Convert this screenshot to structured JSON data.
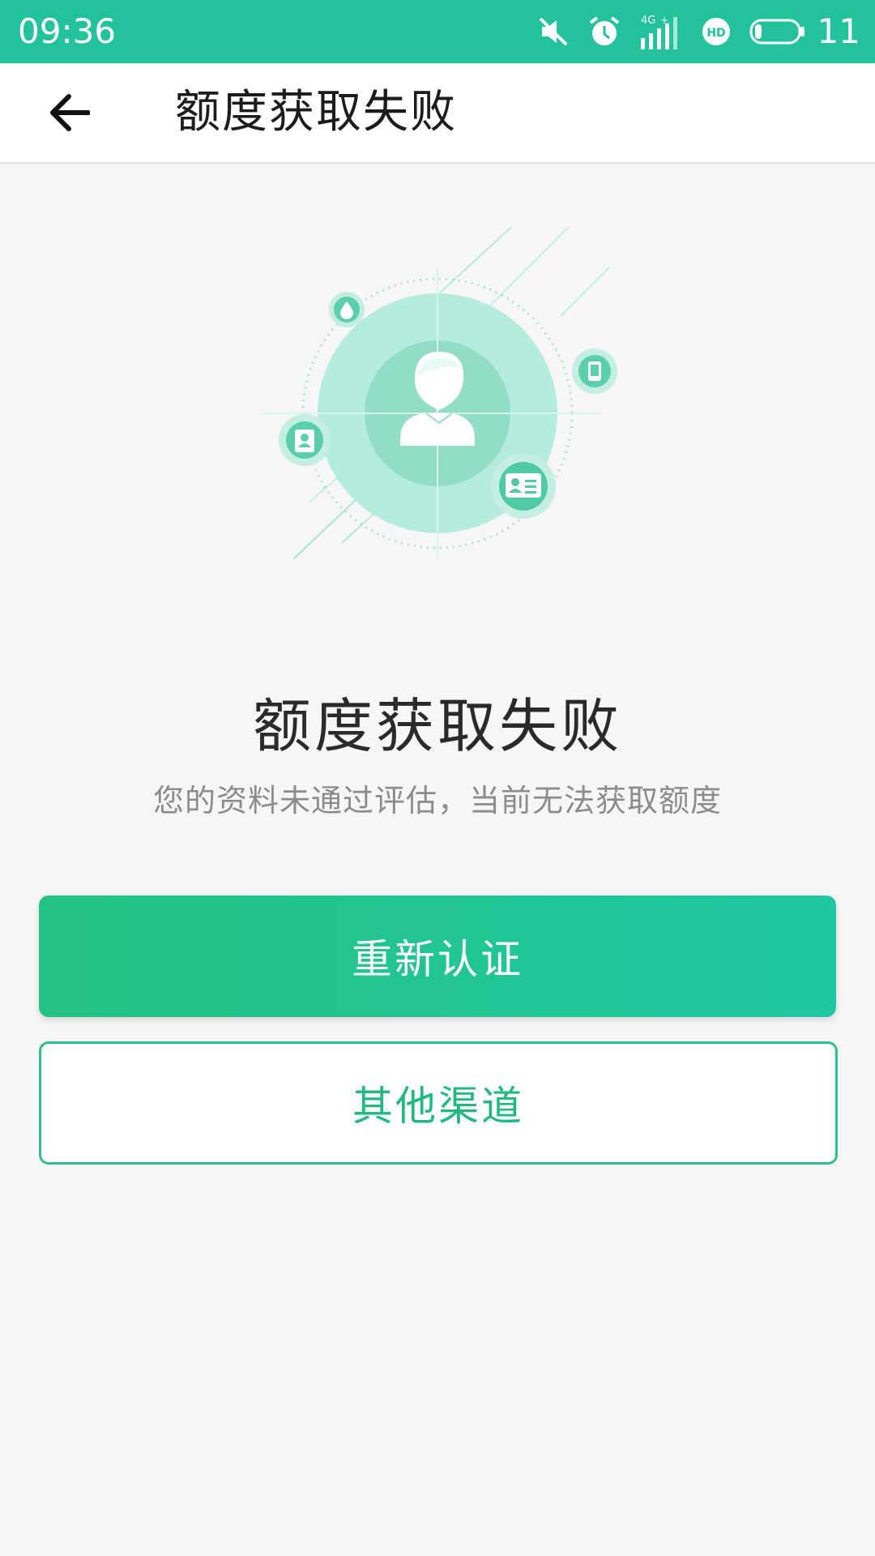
{
  "status_bar": {
    "time": "09:36",
    "network": "4G",
    "battery_level": "11",
    "icons": [
      "mute-icon",
      "alarm-icon",
      "signal-icon",
      "hd-icon",
      "battery-icon"
    ]
  },
  "app_bar": {
    "back_icon": "arrow-left-icon",
    "title": "额度获取失败"
  },
  "hero": {
    "icons": [
      "person-icon",
      "drop-icon",
      "phone-icon",
      "contacts-icon",
      "id-card-icon"
    ]
  },
  "result": {
    "title": "额度获取失败",
    "subtitle": "您的资料未通过评估，当前无法获取额度"
  },
  "actions": {
    "primary_label": "重新认证",
    "secondary_label": "其他渠道"
  },
  "colors": {
    "accent": "#22c29c",
    "button_start": "#22c383",
    "button_end": "#21c7a2",
    "outline": "#2fbf8e",
    "background": "#f6f7f5"
  }
}
